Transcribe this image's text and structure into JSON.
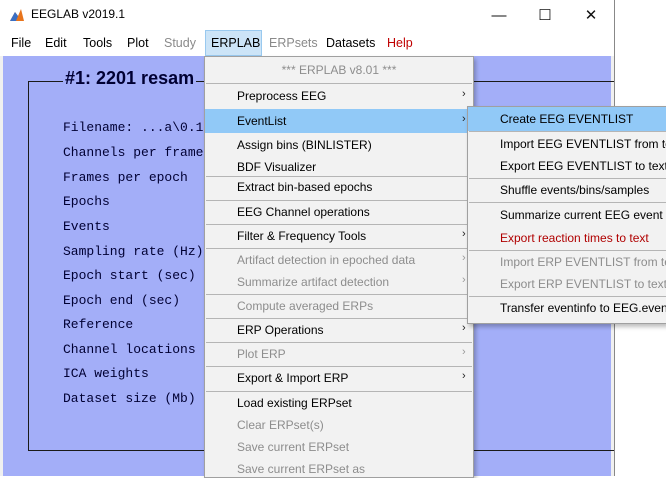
{
  "window": {
    "title": "EEGLAB v2019.1",
    "controls": {
      "minimize": "—",
      "maximize": "☐",
      "close": "✕"
    }
  },
  "menubar": {
    "items": [
      {
        "label": "File"
      },
      {
        "label": "Edit"
      },
      {
        "label": "Tools"
      },
      {
        "label": "Plot"
      },
      {
        "label": "Study"
      },
      {
        "label": "ERPLAB"
      },
      {
        "label": "ERPsets"
      },
      {
        "label": "Datasets"
      },
      {
        "label": "Help"
      }
    ],
    "resize_glyph": "◣"
  },
  "dataset": {
    "title": "#1: 2201 resam",
    "rows": [
      "Filename: ...a\\0.1",
      "Channels per frame",
      "Frames per epoch",
      "Epochs",
      "Events",
      "Sampling rate (Hz)",
      "Epoch start (sec)",
      "Epoch end (sec)",
      "Reference",
      "Channel locations",
      "ICA weights",
      "Dataset size (Mb)"
    ]
  },
  "erplab_menu": {
    "header": "*** ERPLAB v8.01 ***",
    "items": [
      {
        "label": "Preprocess EEG",
        "submenu": true
      },
      {
        "label": "EventList",
        "submenu": true
      },
      {
        "label": "Assign bins (BINLISTER)"
      },
      {
        "label": "BDF Visualizer"
      },
      {
        "label": "Extract bin-based epochs"
      },
      {
        "label": "EEG Channel operations"
      },
      {
        "label": "Filter & Frequency Tools",
        "submenu": true
      },
      {
        "label": "Artifact detection in epoched data",
        "submenu": true
      },
      {
        "label": "Summarize artifact detection",
        "submenu": true
      },
      {
        "label": "Compute averaged ERPs"
      },
      {
        "label": "ERP Operations",
        "submenu": true
      },
      {
        "label": "Plot ERP",
        "submenu": true
      },
      {
        "label": "Export & Import ERP",
        "submenu": true
      },
      {
        "label": "Load existing ERPset"
      },
      {
        "label": "Clear ERPset(s)"
      },
      {
        "label": "Save current ERPset"
      },
      {
        "label": "Save current ERPset as"
      }
    ]
  },
  "eventlist_menu": {
    "items": [
      {
        "label": "Create EEG EVENTLIST"
      },
      {
        "label": "Import EEG EVENTLIST from tex"
      },
      {
        "label": "Export EEG EVENTLIST to text fil"
      },
      {
        "label": "Shuffle events/bins/samples"
      },
      {
        "label": "Summarize current EEG event co"
      },
      {
        "label": "Export reaction times to text"
      },
      {
        "label": "Import ERP EVENTLIST from tex"
      },
      {
        "label": "Export ERP EVENTLIST to text fil"
      },
      {
        "label": "Transfer eventinfo to EEG.event"
      }
    ]
  },
  "submenu_arrow": "›",
  "colors": {
    "panel_bg": "#a3aef8",
    "highlight": "#91c9f7",
    "menubar_active": "#cce4f7",
    "help_red": "#c00000",
    "reaction_red": "#b00000"
  }
}
